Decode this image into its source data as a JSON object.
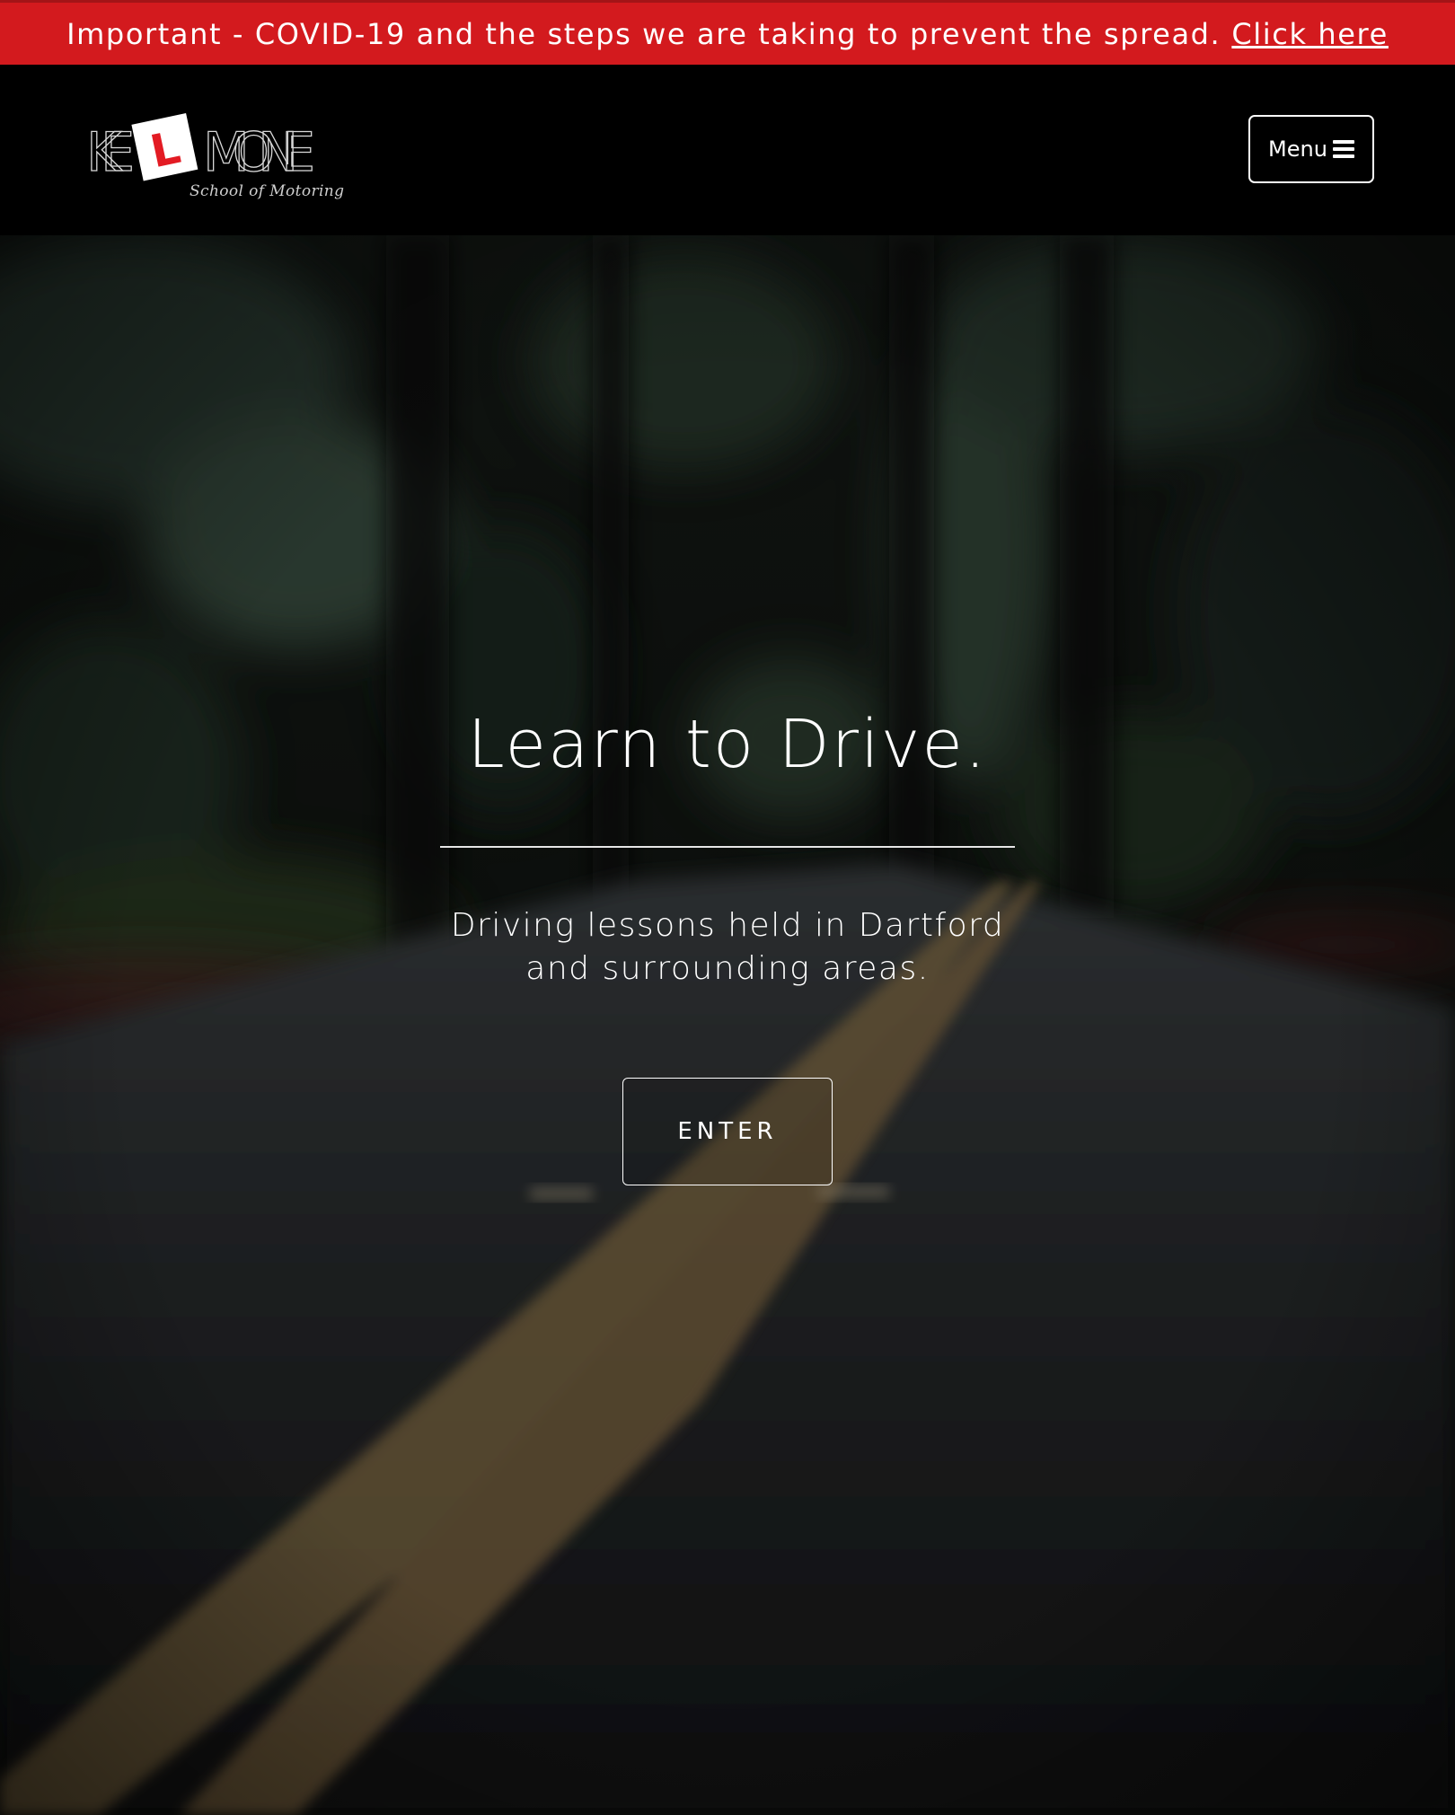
{
  "alert": {
    "text": "Important - COVID-19 and the steps we are taking to prevent the spread.",
    "link_label": "Click here"
  },
  "header": {
    "logo": {
      "letters_left": "KE",
      "plate_letter": "L",
      "letters_right": "MONE",
      "tagline": "School of Motoring"
    },
    "menu_label": "Menu",
    "menu_icon": "hamburger-icon"
  },
  "hero": {
    "title": "Learn to Drive.",
    "subtitle_line1": "Driving lessons held in Dartford",
    "subtitle_line2": "and surrounding areas.",
    "cta_label": "ENTER"
  },
  "colors": {
    "alert_background": "#d31a1e",
    "header_background": "#000000",
    "text": "#ffffff",
    "plate_red": "#e31b23"
  }
}
